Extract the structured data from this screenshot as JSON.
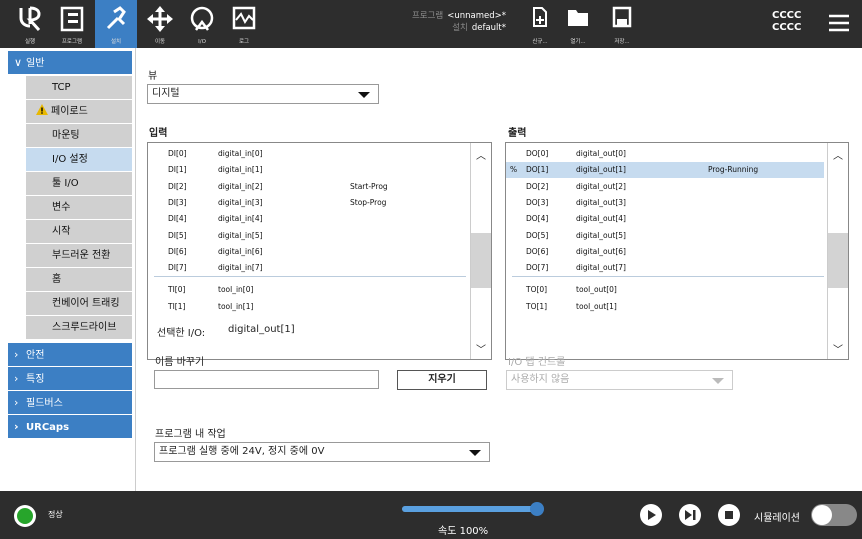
{
  "toolbar": {
    "tabs": [
      {
        "label": "실행",
        "icon": "ur-logo-icon"
      },
      {
        "label": "프로그램",
        "icon": "program-icon"
      },
      {
        "label": "설치",
        "icon": "installation-icon"
      },
      {
        "label": "이동",
        "icon": "move-icon"
      },
      {
        "label": "I/O",
        "icon": "io-icon"
      },
      {
        "label": "로그",
        "icon": "log-icon"
      }
    ],
    "program_key": "프로그램",
    "program_value": "<unnamed>*",
    "install_key": "설치",
    "install_value": "default*",
    "file_buttons": [
      {
        "label": "신규...",
        "icon": "new-file-icon"
      },
      {
        "label": "열기...",
        "icon": "folder-icon"
      },
      {
        "label": "저장...",
        "icon": "save-icon"
      }
    ],
    "user_line1": "CCCC",
    "user_line2": "CCCC"
  },
  "sidebar": {
    "general": "일반",
    "items": [
      "TCP",
      "페이로드",
      "마운팅",
      "I/O 설정",
      "툴 I/O",
      "변수",
      "시작",
      "부드러운 전환",
      "홈",
      "컨베이어 트래킹",
      "스크루드라이브"
    ],
    "safety": "안전",
    "features": "특징",
    "fieldbus": "필드버스",
    "urcaps": "URCaps"
  },
  "main": {
    "view_label": "뷰",
    "view_value": "디지털",
    "input_label": "입력",
    "output_label": "출력",
    "inputs": [
      [
        "DI[0]",
        "digital_in[0]",
        ""
      ],
      [
        "DI[1]",
        "digital_in[1]",
        ""
      ],
      [
        "DI[2]",
        "digital_in[2]",
        "Start-Prog"
      ],
      [
        "DI[3]",
        "digital_in[3]",
        "Stop-Prog"
      ],
      [
        "DI[4]",
        "digital_in[4]",
        ""
      ],
      [
        "DI[5]",
        "digital_in[5]",
        ""
      ],
      [
        "DI[6]",
        "digital_in[6]",
        ""
      ],
      [
        "DI[7]",
        "digital_in[7]",
        ""
      ],
      [
        "TI[0]",
        "tool_in[0]",
        ""
      ],
      [
        "TI[1]",
        "tool_in[1]",
        ""
      ]
    ],
    "outputs": [
      [
        "DO[0]",
        "digital_out[0]",
        ""
      ],
      [
        "DO[1]",
        "digital_out[1]",
        "Prog-Running"
      ],
      [
        "DO[2]",
        "digital_out[2]",
        ""
      ],
      [
        "DO[3]",
        "digital_out[3]",
        ""
      ],
      [
        "DO[4]",
        "digital_out[4]",
        ""
      ],
      [
        "DO[5]",
        "digital_out[5]",
        ""
      ],
      [
        "DO[6]",
        "digital_out[6]",
        ""
      ],
      [
        "DO[7]",
        "digital_out[7]",
        ""
      ],
      [
        "TO[0]",
        "tool_out[0]",
        ""
      ],
      [
        "TO[1]",
        "tool_out[1]",
        ""
      ]
    ],
    "selected_output_marker": "%",
    "selected_io_label": "선택한 I/O:",
    "selected_io_value": "digital_out[1]",
    "rename_label": "이름 바꾸기",
    "rename_value": "",
    "clear_button": "지우기",
    "tab_control_label": "I/O 탭 컨트롤",
    "tab_control_value": "사용하지 않음",
    "program_action_label": "프로그램 내 작업",
    "program_action_value": "프로그램 실행 중에 24V, 정지 중에 0V"
  },
  "footer": {
    "status": "정상",
    "speed": "속도 100%",
    "speed_fraction": 0.95,
    "simulation": "시뮬레이션"
  }
}
